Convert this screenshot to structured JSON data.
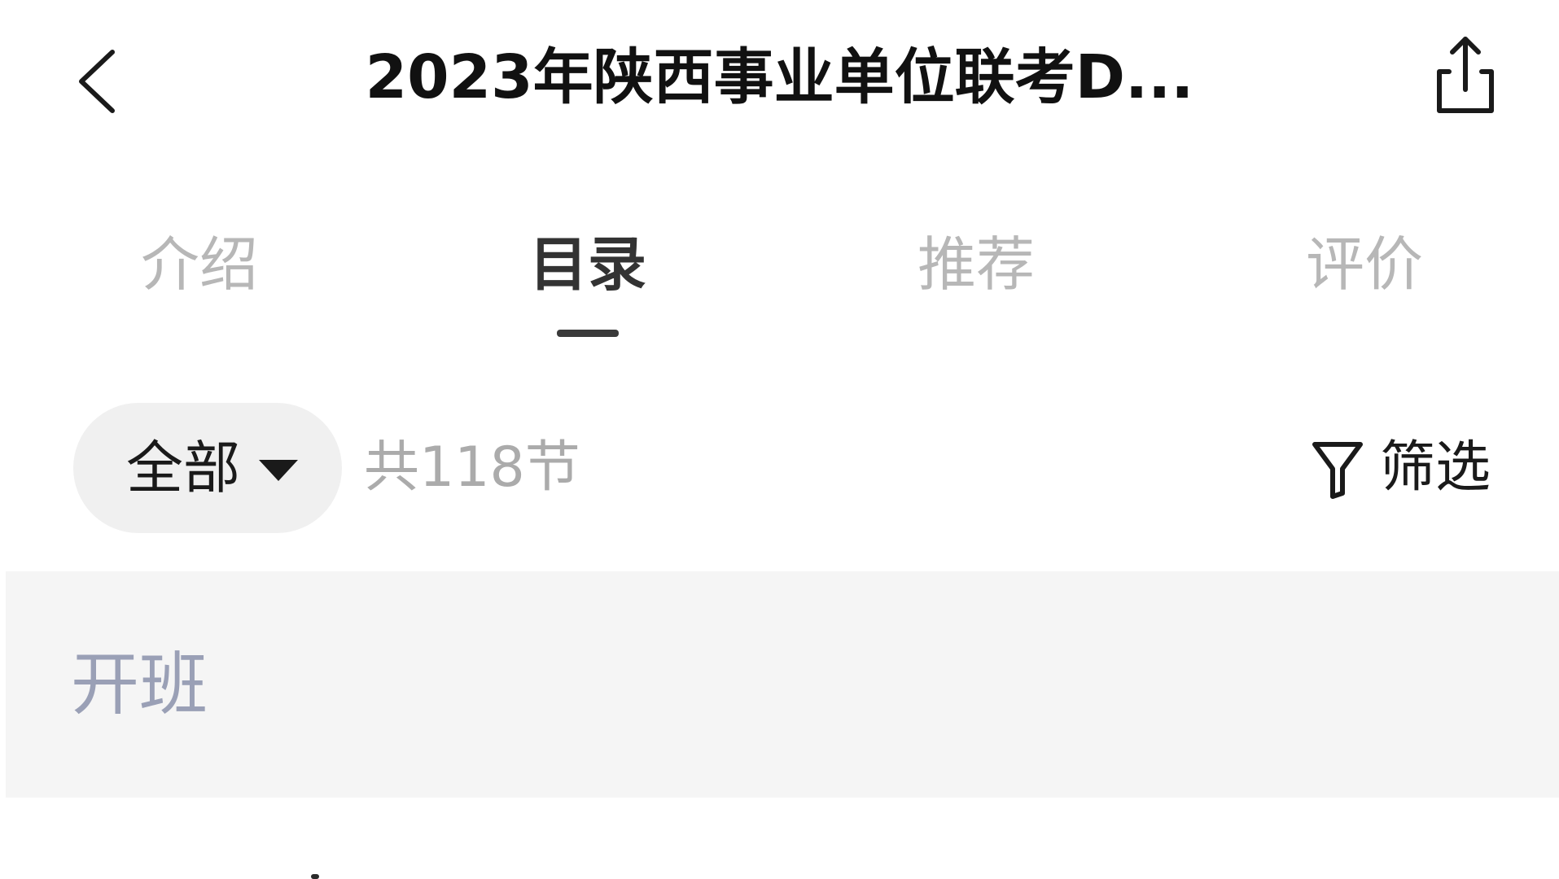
{
  "header": {
    "title": "2023年陕西事业单位联考D...",
    "back_icon": "chevron-left-icon",
    "share_icon": "share-icon"
  },
  "tabs": [
    {
      "label": "介绍",
      "active": false
    },
    {
      "label": "目录",
      "active": true
    },
    {
      "label": "推荐",
      "active": false
    },
    {
      "label": "评价",
      "active": false
    }
  ],
  "filter_bar": {
    "scope_label": "全部",
    "scope_icon": "caret-down-icon",
    "total": "共118节",
    "filter_label": "筛选",
    "filter_icon": "funnel-icon"
  },
  "section": {
    "title": "开班"
  },
  "colors": {
    "active_tab": "#333333",
    "inactive_tab": "#b7b7b7",
    "section_bg": "#f5f5f5",
    "section_title": "#9aa0b6",
    "dropdown_bg": "#f0f0f0"
  }
}
